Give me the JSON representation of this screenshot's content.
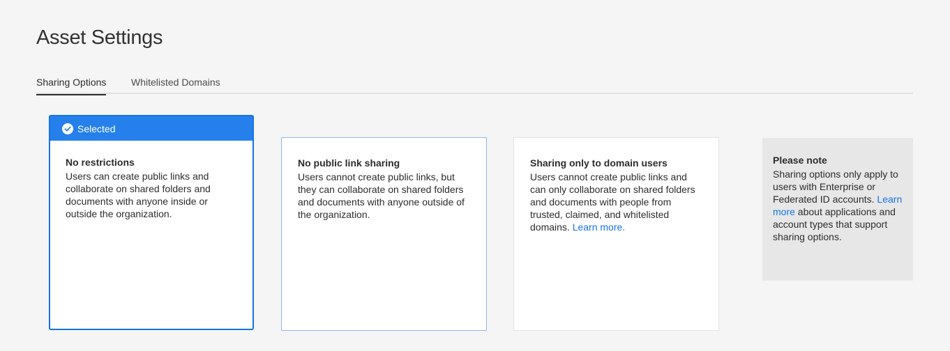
{
  "page": {
    "title": "Asset Settings"
  },
  "tabs": [
    {
      "label": "Sharing Options",
      "active": true
    },
    {
      "label": "Whitelisted Domains",
      "active": false
    }
  ],
  "options": [
    {
      "selected_label": "Selected",
      "title": "No restrictions",
      "description": "Users can create public links and collaborate on shared folders and documents with anyone inside or outside the organization.",
      "selected": true
    },
    {
      "title": "No public link sharing",
      "description": "Users cannot create public links, but they can collaborate on shared folders and documents with anyone outside of the organization.",
      "selected": false
    },
    {
      "title": "Sharing only to domain users",
      "description": "Users cannot create public links and can only collaborate on shared folders and documents with people from trusted, claimed, and whitelisted domains.",
      "link": "Learn more.",
      "selected": false
    }
  ],
  "note": {
    "title": "Please note",
    "text_before": "Sharing options only apply to users with Enterprise or Federated ID accounts.",
    "link": "Learn more",
    "text_after": "about applications and account types that support sharing options."
  },
  "colors": {
    "accent": "#1473e6",
    "selected_header": "#2680eb",
    "background": "#f5f5f5",
    "note_background": "#e7e7e7"
  },
  "icons": {
    "selected": "checkmark-circle-icon"
  }
}
